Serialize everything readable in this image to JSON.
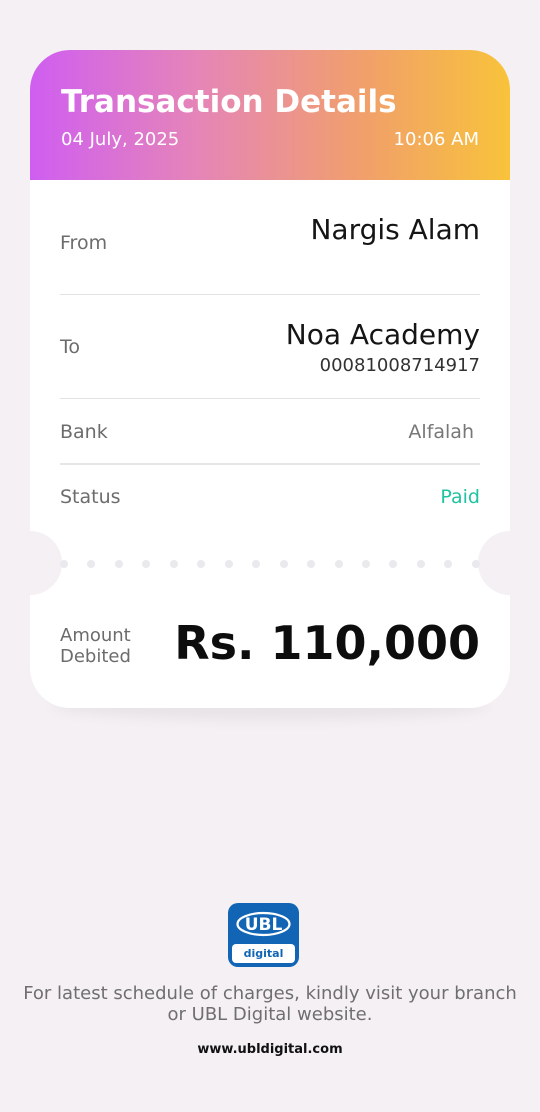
{
  "header": {
    "title": "Transaction Details",
    "date": "04 July, 2025",
    "time": "10:06 AM",
    "gradient_colors": [
      "#cf5ef1",
      "#e585b8",
      "#f1a06a",
      "#f8c33a"
    ]
  },
  "details": {
    "from_label": "From",
    "from_name": "Nargis Alam",
    "to_label": "To",
    "to_name": "Noa Academy",
    "to_account": "00081008714917",
    "bank_label": "Bank",
    "bank_name": "Alfalah",
    "status_label": "Status",
    "status_value": "Paid",
    "status_color": "#20c3a0"
  },
  "amount": {
    "label": "Amount Debited",
    "value": "Rs. 110,000"
  },
  "footer": {
    "logo_icon": "ubl-logo",
    "logo_sub": "digital",
    "brand_color": "#1265b4",
    "note": "For latest schedule of charges, kindly visit your branch or UBL Digital website.",
    "url": "www.ubldigital.com"
  }
}
